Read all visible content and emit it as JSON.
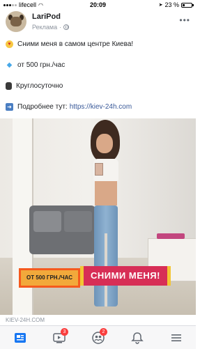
{
  "status_bar": {
    "carrier": "lifecell",
    "time": "20:09",
    "battery_percent": "23 %",
    "battery_level": 0.23
  },
  "post": {
    "author": "LariPod",
    "sponsored": "Реклама",
    "lines": [
      {
        "icon": "heart-eyes-emoji-icon",
        "text": "Сними меня в самом центре Киева!"
      },
      {
        "icon": "diamond-emoji-icon",
        "text": "от 500 грн./час"
      },
      {
        "icon": "watch-emoji-icon",
        "text": "Круглосуточно"
      },
      {
        "icon": "right-arrow-emoji-icon",
        "text": "Подробнее тут:",
        "link": "https://kiev-24h.com"
      }
    ],
    "image": {
      "banner_left": "ОТ 500 ГРН./ЧАС",
      "banner_right": "СНИМИ МЕНЯ!"
    },
    "caption": "KIEV-24H.COM"
  },
  "tab_bar": {
    "tabs": [
      {
        "name": "news-feed-icon",
        "badge": ""
      },
      {
        "name": "watch-video-icon",
        "badge": "3"
      },
      {
        "name": "groups-icon",
        "badge": "2"
      },
      {
        "name": "notifications-bell-icon",
        "badge": ""
      },
      {
        "name": "menu-icon",
        "badge": ""
      }
    ]
  },
  "colors": {
    "accent": "#385898",
    "badge": "#fa3e3e",
    "banner_orange": "#f2a93b",
    "banner_red": "#d72e56"
  }
}
